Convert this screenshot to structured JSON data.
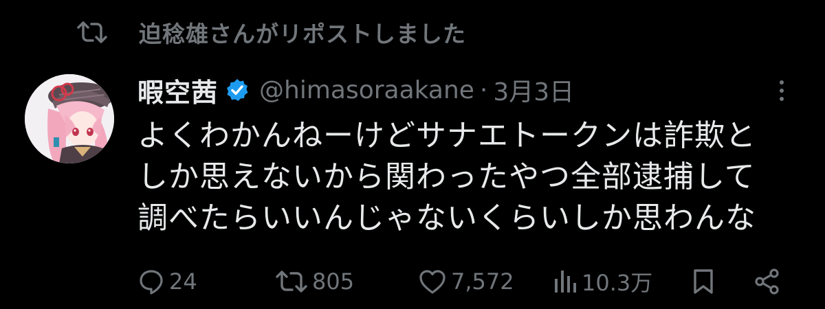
{
  "repost": {
    "text": "迫稔雄さんがリポストしました",
    "icon": "repost-icon"
  },
  "post": {
    "author_name": "暇空茜",
    "verified": true,
    "handle": "@himasoraakane",
    "separator": "·",
    "date": "3月3日",
    "text_lines": [
      "よくわかんねーけどサナエトークンは詐欺と",
      "しか思えないから関わったやつ全部逮捕して",
      "調べたらいいんじゃないくらいしか思わんな"
    ]
  },
  "actions": {
    "replies": "24",
    "reposts": "805",
    "likes": "7,572",
    "views": "10.3万"
  },
  "colors": {
    "background": "#000000",
    "text_primary": "#e7e9ea",
    "text_secondary": "#71767b",
    "verified_blue": "#1d9bf0"
  }
}
